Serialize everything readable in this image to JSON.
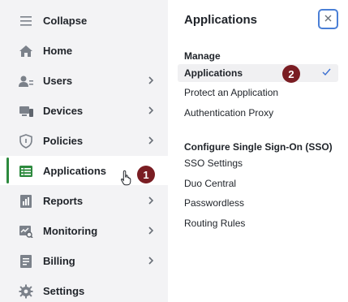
{
  "sidebar": {
    "items": [
      {
        "label": "Collapse",
        "icon": "hamburger-icon",
        "has_chevron": false
      },
      {
        "label": "Home",
        "icon": "home-icon",
        "has_chevron": false
      },
      {
        "label": "Users",
        "icon": "users-icon",
        "has_chevron": true
      },
      {
        "label": "Devices",
        "icon": "devices-icon",
        "has_chevron": true
      },
      {
        "label": "Policies",
        "icon": "shield-icon",
        "has_chevron": true
      },
      {
        "label": "Applications",
        "icon": "applications-icon",
        "has_chevron": false,
        "active": true
      },
      {
        "label": "Reports",
        "icon": "reports-icon",
        "has_chevron": true
      },
      {
        "label": "Monitoring",
        "icon": "monitoring-icon",
        "has_chevron": true
      },
      {
        "label": "Billing",
        "icon": "billing-icon",
        "has_chevron": true
      },
      {
        "label": "Settings",
        "icon": "gear-icon",
        "has_chevron": false
      }
    ]
  },
  "annotations": {
    "step1": "1",
    "step2": "2"
  },
  "panel": {
    "title": "Applications",
    "sections": [
      {
        "heading": "Manage",
        "items": [
          "Applications",
          "Protect an Application",
          "Authentication Proxy"
        ],
        "selected": "Applications"
      },
      {
        "heading": "Configure Single Sign-On (SSO)",
        "items": [
          "SSO Settings",
          "Duo Central",
          "Passwordless",
          "Routing Rules"
        ]
      }
    ]
  },
  "colors": {
    "accent_green": "#2d8a3e",
    "badge": "#7a1d23",
    "focus_blue": "#4a7fd6",
    "check_blue": "#3b6fd1"
  }
}
